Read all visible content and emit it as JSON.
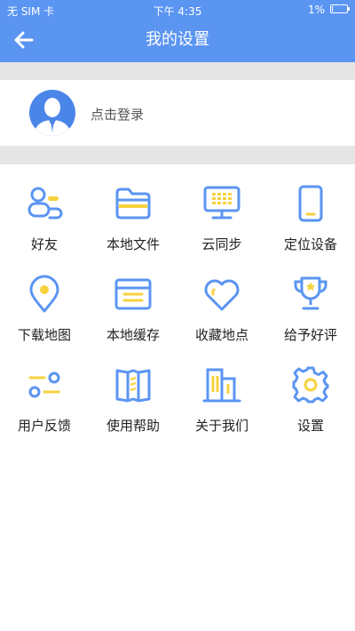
{
  "status_bar": {
    "carrier": "无 SIM 卡",
    "time": "下午 4:35",
    "battery": "1%",
    "battery_level": 0.01
  },
  "header": {
    "title": "我的设置",
    "back_icon": "arrow-left-icon"
  },
  "profile": {
    "login_text": "点击登录",
    "avatar_icon": "user-avatar-icon"
  },
  "colors": {
    "primary": "#5b95f2",
    "accent": "#f7d23e",
    "separator": "#e6e6e6"
  },
  "grid": {
    "items": [
      {
        "label": "好友",
        "icon": "friends-icon"
      },
      {
        "label": "本地文件",
        "icon": "folder-icon"
      },
      {
        "label": "云同步",
        "icon": "cloud-sync-monitor-icon"
      },
      {
        "label": "定位设备",
        "icon": "phone-device-icon"
      },
      {
        "label": "下载地图",
        "icon": "map-pin-icon"
      },
      {
        "label": "本地缓存",
        "icon": "cache-icon"
      },
      {
        "label": "收藏地点",
        "icon": "heart-icon"
      },
      {
        "label": "给予好评",
        "icon": "trophy-icon"
      },
      {
        "label": "用户反馈",
        "icon": "feedback-toggle-icon"
      },
      {
        "label": "使用帮助",
        "icon": "help-book-icon"
      },
      {
        "label": "关于我们",
        "icon": "buildings-icon"
      },
      {
        "label": "设置",
        "icon": "gear-icon"
      }
    ]
  }
}
